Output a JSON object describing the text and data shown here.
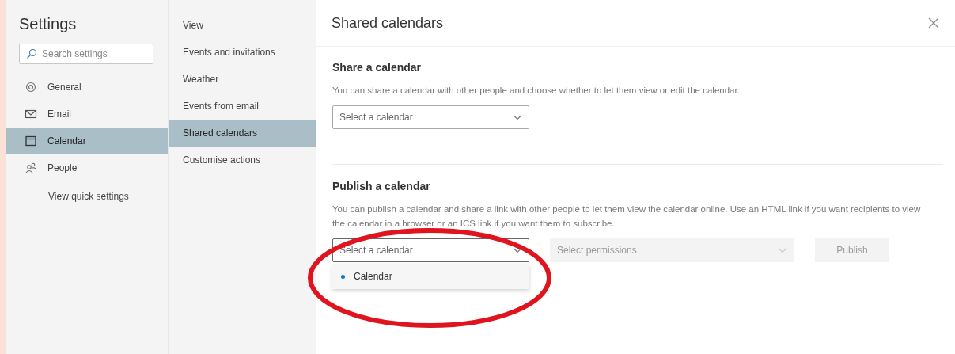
{
  "sidebar": {
    "title": "Settings",
    "search": {
      "placeholder": "Search settings"
    },
    "items": [
      {
        "label": "General",
        "kind": "gear",
        "selected": false
      },
      {
        "label": "Email",
        "kind": "mail",
        "selected": false
      },
      {
        "label": "Calendar",
        "kind": "calendar",
        "selected": true
      },
      {
        "label": "People",
        "kind": "people",
        "selected": false
      },
      {
        "label": "View quick settings",
        "kind": "plain",
        "selected": false
      }
    ]
  },
  "subnav": {
    "items": [
      {
        "label": "View",
        "selected": false
      },
      {
        "label": "Events and invitations",
        "selected": false
      },
      {
        "label": "Weather",
        "selected": false
      },
      {
        "label": "Events from email",
        "selected": false
      },
      {
        "label": "Shared calendars",
        "selected": true
      },
      {
        "label": "Customise actions",
        "selected": false
      }
    ]
  },
  "panel": {
    "title": "Shared calendars",
    "sections": [
      {
        "heading": "Share a calendar",
        "description": "You can share a calendar with other people and choose whether to let them view or edit the calendar.",
        "controls": [
          {
            "kind": "select",
            "placeholder": "Select a calendar",
            "disabled": false
          }
        ]
      },
      {
        "heading": "Publish a calendar",
        "description": "You can publish a calendar and share a link with other people to let them view the calendar online. Use an HTML link if you want recipients to view the calendar in a browser or an ICS link if you want them to subscribe.",
        "controls": [
          {
            "kind": "select",
            "placeholder": "Select a calendar",
            "disabled": false,
            "expanded": true,
            "options": [
              {
                "label": "Calendar",
                "color": "#0078d4"
              }
            ]
          },
          {
            "kind": "select",
            "placeholder": "Select permissions",
            "disabled": true
          },
          {
            "kind": "button",
            "label": "Publish",
            "disabled": true
          }
        ]
      }
    ]
  }
}
